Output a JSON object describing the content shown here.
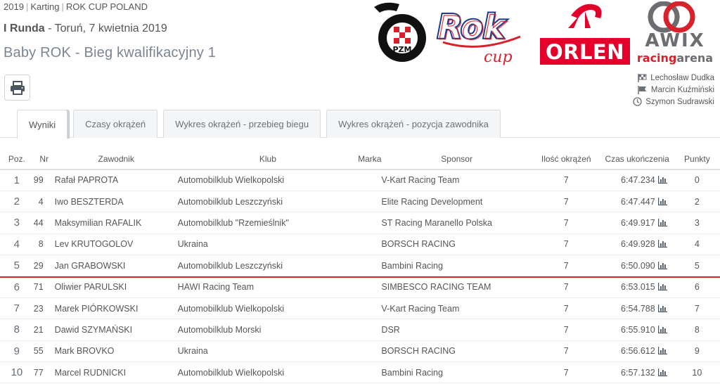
{
  "breadcrumb": {
    "year": "2019",
    "category": "Karting",
    "series": "ROK CUP POLAND"
  },
  "round": {
    "name": "I Runda",
    "location_date": "Toruń, 7 kwietnia 2019"
  },
  "page_title": "Baby ROK - Bieg kwalifikacyjny 1",
  "logos": {
    "pzm": "PZM",
    "rok": "Rok",
    "rok_sub": "cup",
    "orlen": "ORLEN",
    "awix": "AWIX",
    "awix_sub1": "racing",
    "awix_sub2": "arena"
  },
  "officials": [
    {
      "icon": "checkered-flag-icon",
      "name": "Lechosław Dudka"
    },
    {
      "icon": "flag-icon",
      "name": "Marcin Kuźmiński"
    },
    {
      "icon": "clock-icon",
      "name": "Szymon Sudrawski"
    }
  ],
  "tabs": [
    {
      "label": "Wyniki",
      "active": true
    },
    {
      "label": "Czasy okrążeń",
      "active": false
    },
    {
      "label": "Wykres okrążeń - przebieg biegu",
      "active": false
    },
    {
      "label": "Wykres okrążeń - pozycja zawodnika",
      "active": false
    }
  ],
  "table": {
    "headers": [
      "Poz.",
      "Nr",
      "Zawodnik",
      "Klub",
      "Marka",
      "Sponsor",
      "Ilość okrążeń",
      "Czas ukończenia",
      "Punkty"
    ],
    "rows": [
      {
        "poz": "1",
        "nr": "99",
        "name": "Rafał PAPROTA",
        "club": "Automobilklub Wielkopolski",
        "brand": "",
        "sponsor": "V-Kart Racing Team",
        "laps": "7",
        "time": "6:47.234",
        "pts": "0"
      },
      {
        "poz": "2",
        "nr": "4",
        "name": "Iwo BESZTERDA",
        "club": "Automobilklub Leszczyński",
        "brand": "",
        "sponsor": "Elite Racing Development",
        "laps": "7",
        "time": "6:47.447",
        "pts": "2"
      },
      {
        "poz": "3",
        "nr": "44",
        "name": "Maksymilian RAFALIK",
        "club": "Automobilklub \"Rzemieślnik\"",
        "brand": "",
        "sponsor": "ST Racing Maranello Polska",
        "laps": "7",
        "time": "6:49.917",
        "pts": "3"
      },
      {
        "poz": "4",
        "nr": "8",
        "name": "Lev KRUTOGOLOV",
        "club": "Ukraina",
        "brand": "",
        "sponsor": "BORSCH RACING",
        "laps": "7",
        "time": "6:49.928",
        "pts": "4"
      },
      {
        "poz": "5",
        "nr": "29",
        "name": "Jan GRABOWSKI",
        "club": "Automobilklub Leszczyński",
        "brand": "",
        "sponsor": "Bambini Racing",
        "laps": "7",
        "time": "6:50.090",
        "pts": "5"
      },
      {
        "poz": "6",
        "nr": "71",
        "name": "Oliwier PARULSKI",
        "club": "HAWI Racing Team",
        "brand": "",
        "sponsor": "SIMBESCO RACING TEAM",
        "laps": "7",
        "time": "6:53.015",
        "pts": "6"
      },
      {
        "poz": "7",
        "nr": "23",
        "name": "Marek PIÓRKOWSKI",
        "club": "Automobilklub Wielkopolski",
        "brand": "",
        "sponsor": "V-Kart Racing Team",
        "laps": "7",
        "time": "6:54.788",
        "pts": "7"
      },
      {
        "poz": "8",
        "nr": "21",
        "name": "Dawid SZYMAŃSKI",
        "club": "Automobilklub Morski",
        "brand": "",
        "sponsor": "DSR",
        "laps": "7",
        "time": "6:55.910",
        "pts": "8"
      },
      {
        "poz": "9",
        "nr": "55",
        "name": "Mark BROVKO",
        "club": "Ukraina",
        "brand": "",
        "sponsor": "BORSCH RACING",
        "laps": "7",
        "time": "6:56.612",
        "pts": "9"
      },
      {
        "poz": "10",
        "nr": "77",
        "name": "Marcel RUDNICKI",
        "club": "Automobilklub Wielkopolski",
        "brand": "",
        "sponsor": "Bambini Racing",
        "laps": "7",
        "time": "6:57.132",
        "pts": "10"
      }
    ]
  },
  "colors": {
    "cut_line": "#e0242b",
    "rok_blue": "#1d3a8a",
    "rok_red": "#d8212a",
    "orlen_red": "#e4002b",
    "awix_grey": "#6b6d70"
  }
}
